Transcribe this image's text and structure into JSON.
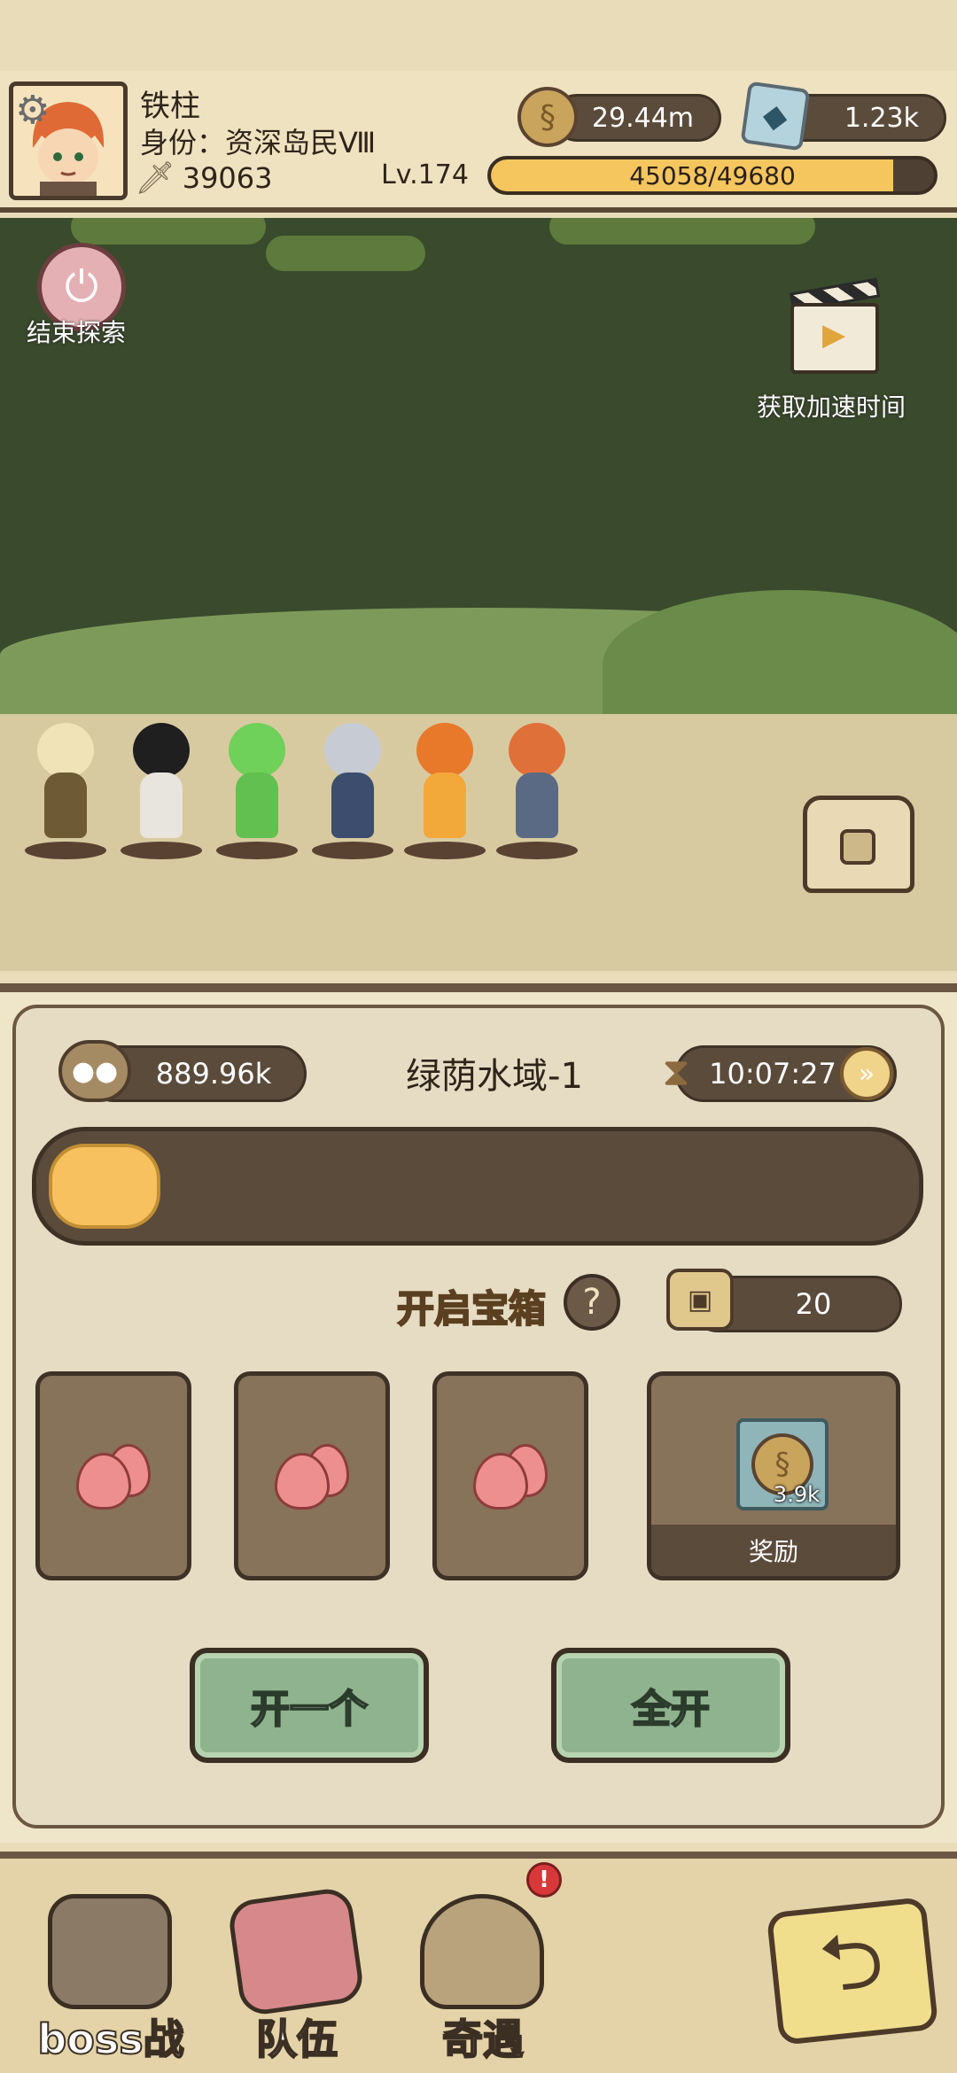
{
  "player": {
    "name": "铁柱",
    "title": "身份：资深岛民Ⅷ",
    "power": "39063",
    "level": "Lv.174",
    "xp_text": "45058/49680",
    "xp_fraction": 0.907
  },
  "resources": {
    "coins": "29.44m",
    "gems": "1.23k"
  },
  "scene": {
    "end_explore_label": "结束探索",
    "speed_up_label": "获取加速时间"
  },
  "panel": {
    "seeds": "889.96k",
    "region": "绿荫水域-1",
    "timer": "10:07:27",
    "progress_fraction": 0.13,
    "open_chest_label": "开启宝箱",
    "keys": "20",
    "reward_label": "奖励",
    "reward_qty": "3.9k",
    "open_one_label": "开一个",
    "open_all_label": "全开"
  },
  "nav": {
    "boss_label": "boss战",
    "team_label": "队伍",
    "event_label": "奇遇",
    "event_badge": "!"
  },
  "colors": {
    "accent_yellow": "#f5c65e",
    "panel_brown": "#5b4b3b",
    "button_green": "#8fb28f",
    "badge_red": "#d8383a"
  }
}
